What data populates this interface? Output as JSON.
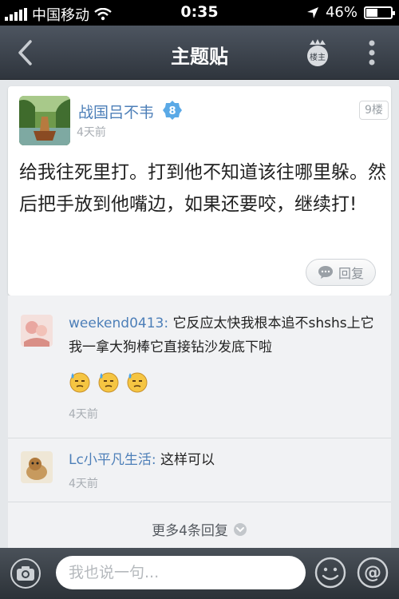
{
  "status_bar": {
    "carrier": "中国移动",
    "time": "0:35",
    "battery": "46%",
    "battery_level": 0.46
  },
  "nav": {
    "title": "主题贴",
    "owner_label": "楼主"
  },
  "post": {
    "author": "战国吕不韦",
    "level": "8",
    "time": "4天前",
    "floor": "9楼",
    "body": "给我往死里打。打到他不知道该往哪里躲。然后把手放到他嘴边，如果还要咬，继续打!",
    "reply_label": "回复"
  },
  "comments": [
    {
      "user": "weekend0413:",
      "text": " 它反应太快我根本追不shshs上它 我一拿大狗棒它直接钻沙发底下啦",
      "time": "4天前"
    },
    {
      "user": "Lc小平凡生活:",
      "text": " 这样可以",
      "time": "4天前"
    }
  ],
  "more_replies": "更多4条回复",
  "bottom_bar": {
    "input_placeholder": "我也说一句..."
  },
  "colors": {
    "link": "#4d7fb8",
    "nav_bg": "#3b424a",
    "level_badge": "#5aa9e6"
  }
}
